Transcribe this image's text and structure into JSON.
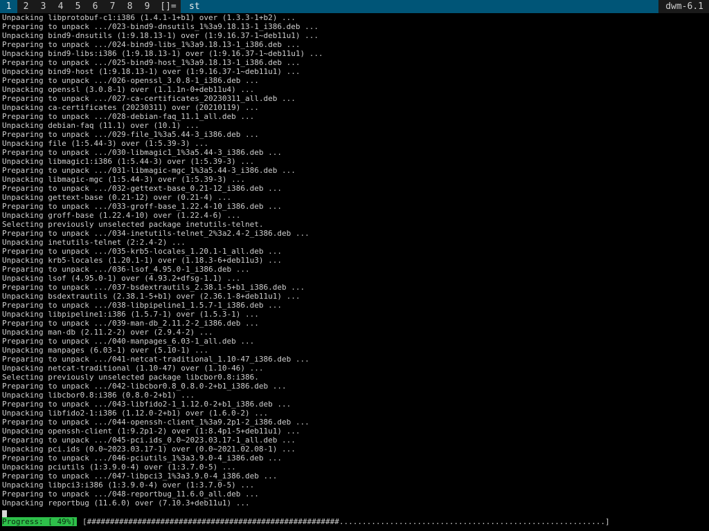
{
  "bar": {
    "tags": [
      "1",
      "2",
      "3",
      "4",
      "5",
      "6",
      "7",
      "8",
      "9"
    ],
    "selected_tag": "1",
    "layout_symbol": "[]=",
    "window_title": "st",
    "status_text": "dwm-6.1"
  },
  "terminal": {
    "lines": [
      "Unpacking libprotobuf-c1:i386 (1.4.1-1+b1) over (1.3.3-1+b2) ...",
      "Preparing to unpack .../023-bind9-dnsutils_1%3a9.18.13-1_i386.deb ...",
      "Unpacking bind9-dnsutils (1:9.18.13-1) over (1:9.16.37-1~deb11u1) ...",
      "Preparing to unpack .../024-bind9-libs_1%3a9.18.13-1_i386.deb ...",
      "Unpacking bind9-libs:i386 (1:9.18.13-1) over (1:9.16.37-1~deb11u1) ...",
      "Preparing to unpack .../025-bind9-host_1%3a9.18.13-1_i386.deb ...",
      "Unpacking bind9-host (1:9.18.13-1) over (1:9.16.37-1~deb11u1) ...",
      "Preparing to unpack .../026-openssl_3.0.8-1_i386.deb ...",
      "Unpacking openssl (3.0.8-1) over (1.1.1n-0+deb11u4) ...",
      "Preparing to unpack .../027-ca-certificates_20230311_all.deb ...",
      "Unpacking ca-certificates (20230311) over (20210119) ...",
      "Preparing to unpack .../028-debian-faq_11.1_all.deb ...",
      "Unpacking debian-faq (11.1) over (10.1) ...",
      "Preparing to unpack .../029-file_1%3a5.44-3_i386.deb ...",
      "Unpacking file (1:5.44-3) over (1:5.39-3) ...",
      "Preparing to unpack .../030-libmagic1_1%3a5.44-3_i386.deb ...",
      "Unpacking libmagic1:i386 (1:5.44-3) over (1:5.39-3) ...",
      "Preparing to unpack .../031-libmagic-mgc_1%3a5.44-3_i386.deb ...",
      "Unpacking libmagic-mgc (1:5.44-3) over (1:5.39-3) ...",
      "Preparing to unpack .../032-gettext-base_0.21-12_i386.deb ...",
      "Unpacking gettext-base (0.21-12) over (0.21-4) ...",
      "Preparing to unpack .../033-groff-base_1.22.4-10_i386.deb ...",
      "Unpacking groff-base (1.22.4-10) over (1.22.4-6) ...",
      "Selecting previously unselected package inetutils-telnet.",
      "Preparing to unpack .../034-inetutils-telnet_2%3a2.4-2_i386.deb ...",
      "Unpacking inetutils-telnet (2:2.4-2) ...",
      "Preparing to unpack .../035-krb5-locales_1.20.1-1_all.deb ...",
      "Unpacking krb5-locales (1.20.1-1) over (1.18.3-6+deb11u3) ...",
      "Preparing to unpack .../036-lsof_4.95.0-1_i386.deb ...",
      "Unpacking lsof (4.95.0-1) over (4.93.2+dfsg-1.1) ...",
      "Preparing to unpack .../037-bsdextrautils_2.38.1-5+b1_i386.deb ...",
      "Unpacking bsdextrautils (2.38.1-5+b1) over (2.36.1-8+deb11u1) ...",
      "Preparing to unpack .../038-libpipeline1_1.5.7-1_i386.deb ...",
      "Unpacking libpipeline1:i386 (1.5.7-1) over (1.5.3-1) ...",
      "Preparing to unpack .../039-man-db_2.11.2-2_i386.deb ...",
      "Unpacking man-db (2.11.2-2) over (2.9.4-2) ...",
      "Preparing to unpack .../040-manpages_6.03-1_all.deb ...",
      "Unpacking manpages (6.03-1) over (5.10-1) ...",
      "Preparing to unpack .../041-netcat-traditional_1.10-47_i386.deb ...",
      "Unpacking netcat-traditional (1.10-47) over (1.10-46) ...",
      "Selecting previously unselected package libcbor0.8:i386.",
      "Preparing to unpack .../042-libcbor0.8_0.8.0-2+b1_i386.deb ...",
      "Unpacking libcbor0.8:i386 (0.8.0-2+b1) ...",
      "Preparing to unpack .../043-libfido2-1_1.12.0-2+b1_i386.deb ...",
      "Unpacking libfido2-1:i386 (1.12.0-2+b1) over (1.6.0-2) ...",
      "Preparing to unpack .../044-openssh-client_1%3a9.2p1-2_i386.deb ...",
      "Unpacking openssh-client (1:9.2p1-2) over (1:8.4p1-5+deb11u1) ...",
      "Preparing to unpack .../045-pci.ids_0.0~2023.03.17-1_all.deb ...",
      "Unpacking pci.ids (0.0~2023.03.17-1) over (0.0~2021.02.08-1) ...",
      "Preparing to unpack .../046-pciutils_1%3a3.9.0-4_i386.deb ...",
      "Unpacking pciutils (1:3.9.0-4) over (1:3.7.0-5) ...",
      "Preparing to unpack .../047-libpci3_1%3a3.9.0-4_i386.deb ...",
      "Unpacking libpci3:i386 (1:3.9.0-4) over (1:3.7.0-5) ...",
      "Preparing to unpack .../048-reportbug_11.6.0_all.deb ...",
      "Unpacking reportbug (11.6.0) over (7.10.3+deb11u1) ..."
    ],
    "progress_label": "Progress: [ 49%]",
    "progress_bar": "[#######################################################..........................................................]",
    "progress_percent": 49
  },
  "colors": {
    "tagbar_background": "#1a1a1a",
    "selected_background": "#005577",
    "progress_label_background": "#2ec04a",
    "terminal_background": "#000000",
    "terminal_foreground": "#cfcfcf"
  }
}
